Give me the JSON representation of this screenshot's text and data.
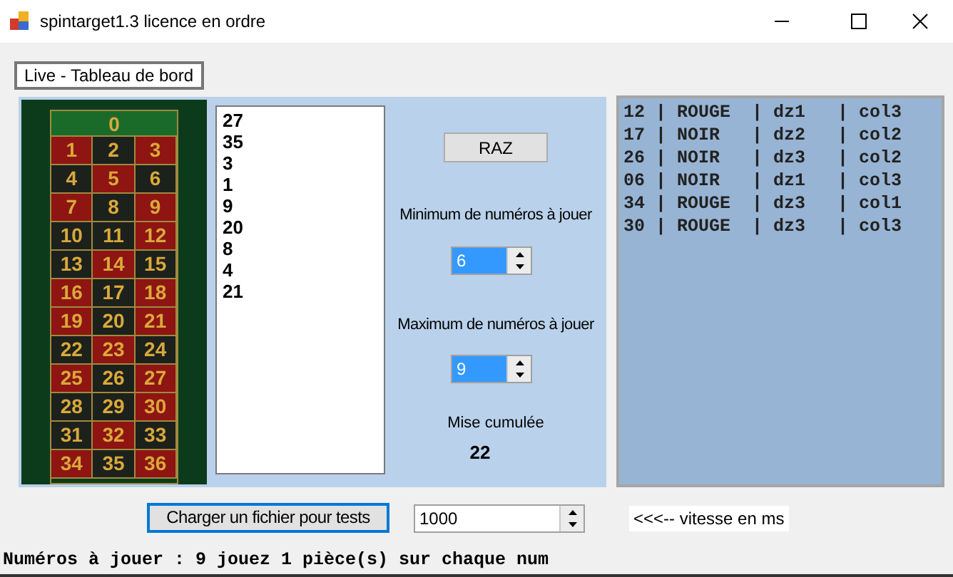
{
  "window": {
    "title": "spintarget1.3 licence en ordre"
  },
  "tabs": [
    {
      "label": "Live - Tableau de bord",
      "selected": true
    }
  ],
  "board": {
    "zero": "0",
    "cells": [
      {
        "label": "1",
        "color": "#8e1512"
      },
      {
        "label": "2",
        "color": "#1d211c"
      },
      {
        "label": "3",
        "color": "#8e1512"
      },
      {
        "label": "4",
        "color": "#1d211c"
      },
      {
        "label": "5",
        "color": "#8e1512"
      },
      {
        "label": "6",
        "color": "#1d211c"
      },
      {
        "label": "7",
        "color": "#8e1512"
      },
      {
        "label": "8",
        "color": "#1d211c"
      },
      {
        "label": "9",
        "color": "#8e1512"
      },
      {
        "label": "10",
        "color": "#1d211c"
      },
      {
        "label": "11",
        "color": "#1d211c"
      },
      {
        "label": "12",
        "color": "#8e1512"
      },
      {
        "label": "13",
        "color": "#1d211c"
      },
      {
        "label": "14",
        "color": "#8e1512"
      },
      {
        "label": "15",
        "color": "#1d211c"
      },
      {
        "label": "16",
        "color": "#8e1512"
      },
      {
        "label": "17",
        "color": "#1d211c"
      },
      {
        "label": "18",
        "color": "#8e1512"
      },
      {
        "label": "19",
        "color": "#8e1512"
      },
      {
        "label": "20",
        "color": "#1d211c"
      },
      {
        "label": "21",
        "color": "#8e1512"
      },
      {
        "label": "22",
        "color": "#1d211c"
      },
      {
        "label": "23",
        "color": "#8e1512"
      },
      {
        "label": "24",
        "color": "#1d211c"
      },
      {
        "label": "25",
        "color": "#8e1512"
      },
      {
        "label": "26",
        "color": "#1d211c"
      },
      {
        "label": "27",
        "color": "#8e1512"
      },
      {
        "label": "28",
        "color": "#1d211c"
      },
      {
        "label": "29",
        "color": "#1d211c"
      },
      {
        "label": "30",
        "color": "#8e1512"
      },
      {
        "label": "31",
        "color": "#1d211c"
      },
      {
        "label": "32",
        "color": "#8e1512"
      },
      {
        "label": "33",
        "color": "#1d211c"
      },
      {
        "label": "34",
        "color": "#8e1512"
      },
      {
        "label": "35",
        "color": "#1d211c"
      },
      {
        "label": "36",
        "color": "#8e1512"
      }
    ]
  },
  "spins": [
    "27",
    "35",
    "3",
    "1",
    "9",
    "20",
    "8",
    "4",
    "21"
  ],
  "raz_button": "RAZ",
  "minimum": {
    "label": "Minimum de numéros à jouer",
    "value": "6"
  },
  "maximum": {
    "label": "Maximum de numéros à jouer",
    "value": "9"
  },
  "mise": {
    "label": "Mise cumulée",
    "value": "22"
  },
  "results": [
    "12 | ROUGE  | dz1   | col3",
    "17 | NOIR   | dz2   | col2",
    "26 | NOIR   | dz3   | col2",
    "06 | NOIR   | dz1   | col3",
    "34 | ROUGE  | dz3   | col1",
    "30 | ROUGE  | dz3   | col3"
  ],
  "load_button": "Charger un fichier pour tests",
  "speed": {
    "value": "1000",
    "label": "<<<-- vitesse en ms"
  },
  "status": "Numéros à jouer : 9 jouez 1 pièce(s) sur chaque num"
}
